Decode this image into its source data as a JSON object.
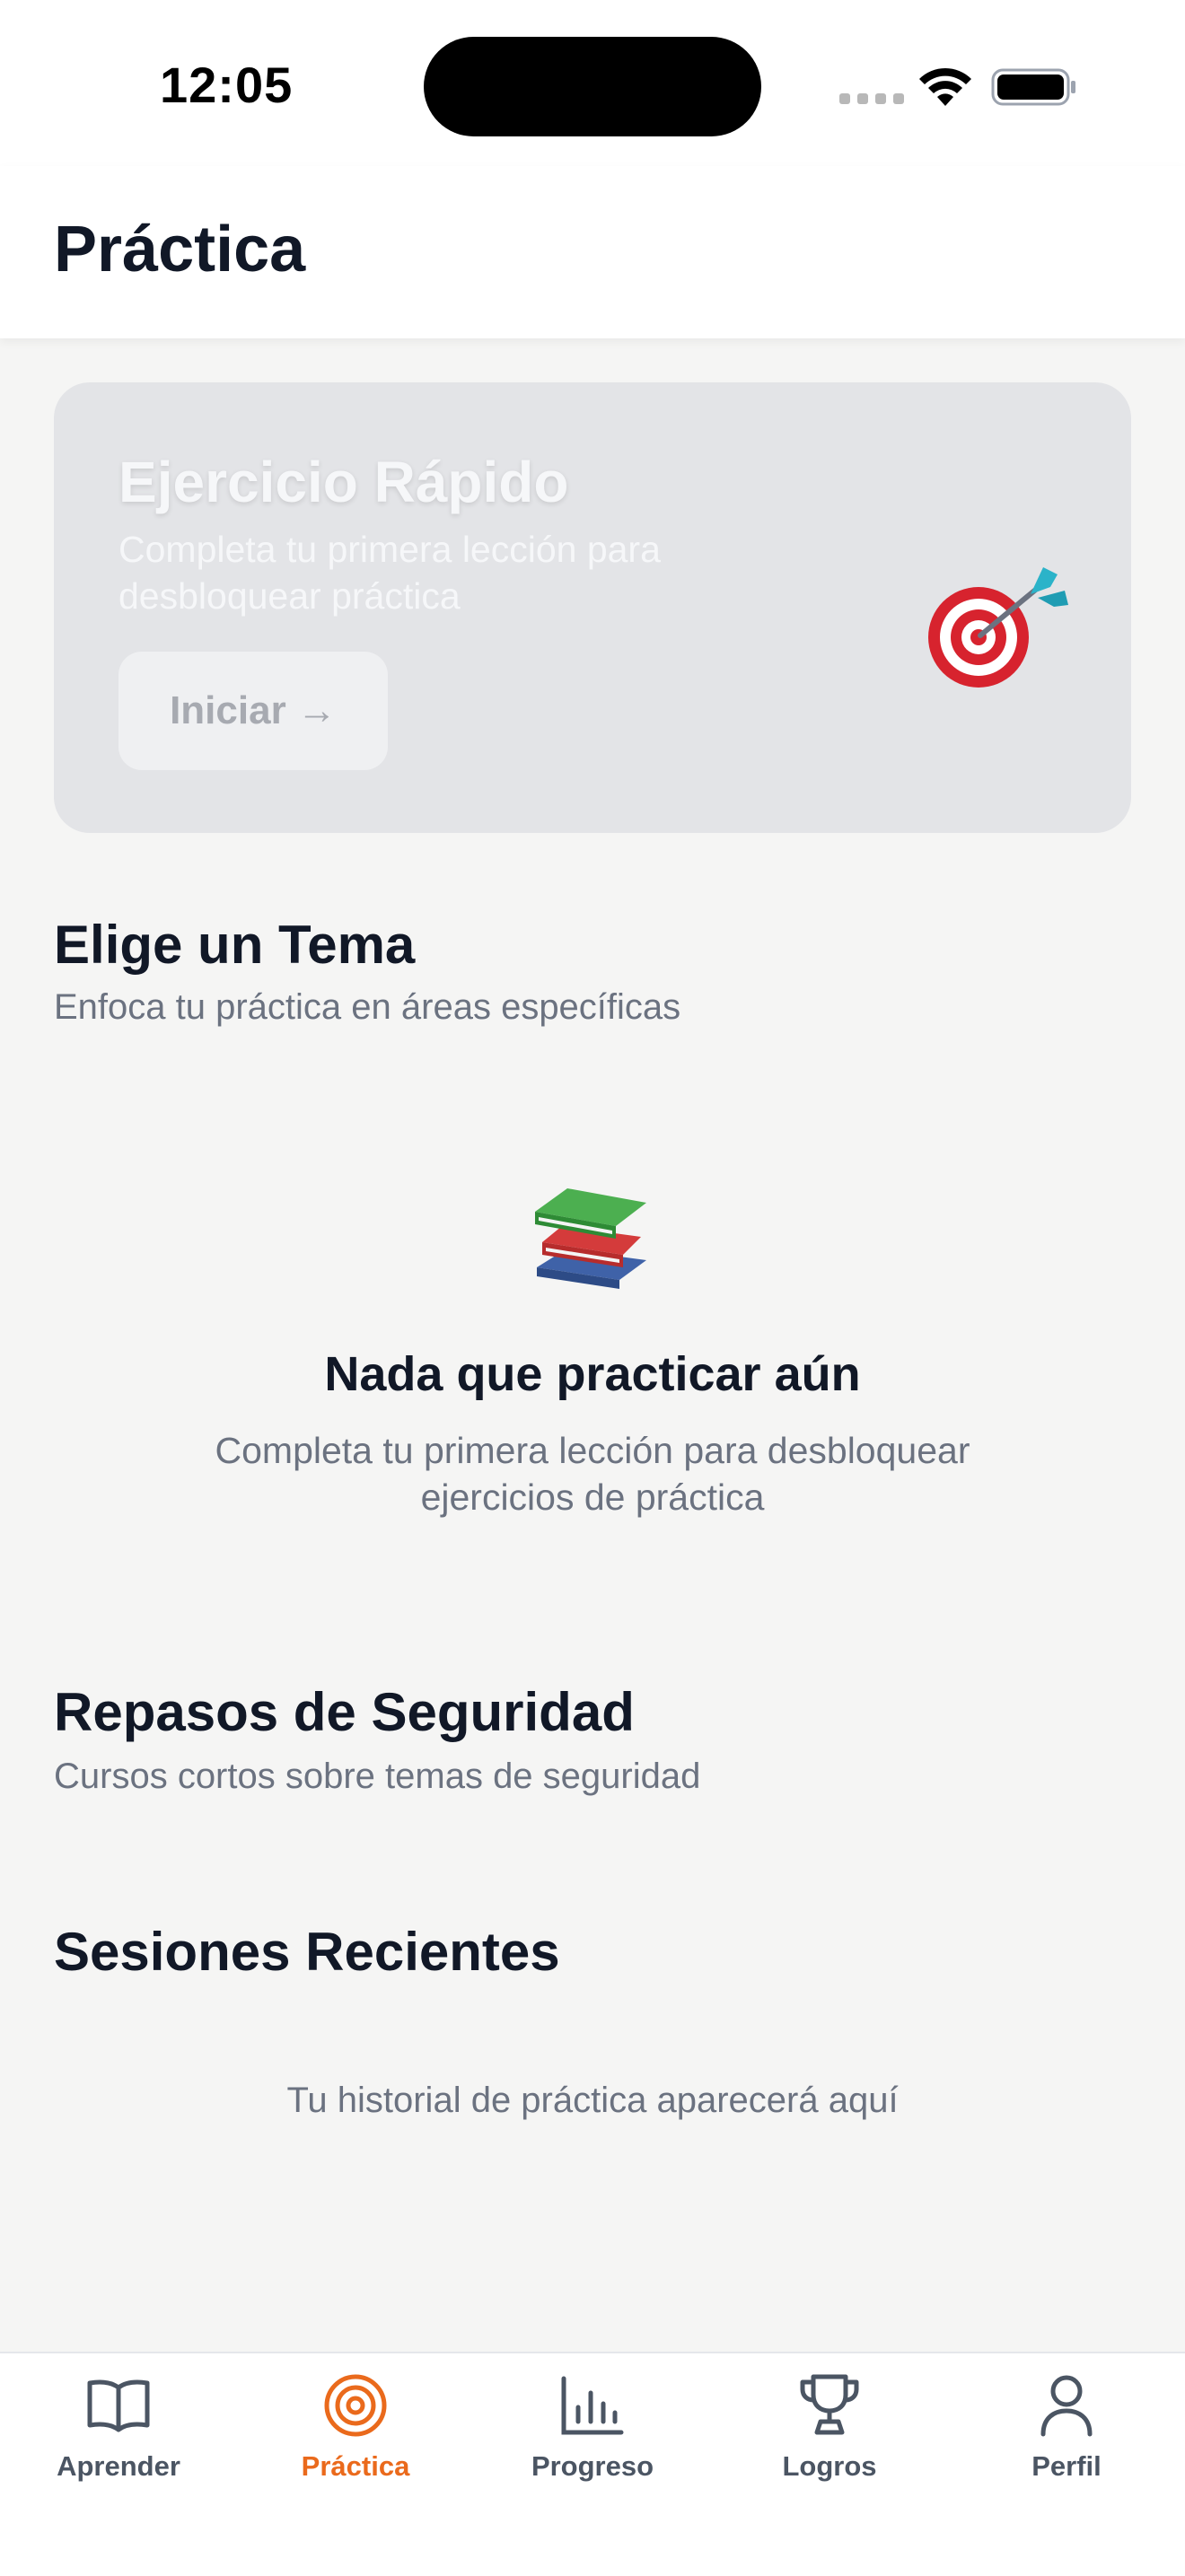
{
  "status_bar": {
    "time": "12:05"
  },
  "header": {
    "title": "Práctica"
  },
  "quick_exercise": {
    "title": "Ejercicio Rápido",
    "subtitle": "Completa tu primera lección para desbloquear práctica",
    "button_label": "Iniciar →",
    "icon": "target-dart-icon"
  },
  "topics": {
    "title": "Elige un Tema",
    "subtitle": "Enfoca tu práctica en áreas específicas",
    "empty_icon": "books-icon",
    "empty_title": "Nada que practicar aún",
    "empty_subtitle": "Completa tu primera lección para desbloquear ejercicios de práctica"
  },
  "refreshers": {
    "title": "Repasos de Seguridad",
    "subtitle": "Cursos cortos sobre temas de seguridad"
  },
  "recent": {
    "title": "Sesiones Recientes",
    "empty_text": "Tu historial de práctica aparecerá aquí"
  },
  "tab_bar": {
    "active_color": "#ea6a1c",
    "inactive_color": "#4b5563",
    "tabs": [
      {
        "label": "Aprender",
        "icon": "book-icon",
        "active": false
      },
      {
        "label": "Práctica",
        "icon": "target-icon",
        "active": true
      },
      {
        "label": "Progreso",
        "icon": "bar-chart-icon",
        "active": false
      },
      {
        "label": "Logros",
        "icon": "trophy-icon",
        "active": false
      },
      {
        "label": "Perfil",
        "icon": "user-icon",
        "active": false
      }
    ]
  }
}
